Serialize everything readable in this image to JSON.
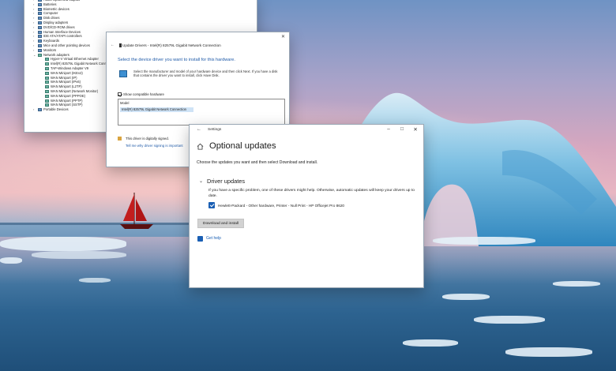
{
  "device_manager": {
    "rows": [
      {
        "label": "Audio inputs and outputs",
        "level": 0
      },
      {
        "label": "Batteries",
        "level": 0
      },
      {
        "label": "Biometric devices",
        "level": 0
      },
      {
        "label": "Computer",
        "level": 0
      },
      {
        "label": "Disk drives",
        "level": 0
      },
      {
        "label": "Display adapters",
        "level": 0
      },
      {
        "label": "DVD/CD-ROM drives",
        "level": 0
      },
      {
        "label": "Human Interface Devices",
        "level": 0
      },
      {
        "label": "IDE ATA/ATAPI controllers",
        "level": 0
      },
      {
        "label": "Keyboards",
        "level": 0
      },
      {
        "label": "Mice and other pointing devices",
        "level": 0
      },
      {
        "label": "Monitors",
        "level": 0
      },
      {
        "label": "Network adapters",
        "level": 0,
        "open": true
      },
      {
        "label": "Hyper-V Virtual Ethernet Adapter",
        "level": 1
      },
      {
        "label": "Intel(R) 82579L Gigabit Network Conn",
        "level": 1
      },
      {
        "label": "TAP-Windows Adapter V9",
        "level": 1
      },
      {
        "label": "WAN Miniport (IKEv2)",
        "level": 1
      },
      {
        "label": "WAN Miniport (IP)",
        "level": 1
      },
      {
        "label": "WAN Miniport (IPv6)",
        "level": 1
      },
      {
        "label": "WAN Miniport (L2TP)",
        "level": 1
      },
      {
        "label": "WAN Miniport (Network Monitor)",
        "level": 1
      },
      {
        "label": "WAN Miniport (PPPOE)",
        "level": 1
      },
      {
        "label": "WAN Miniport (PPTP)",
        "level": 1
      },
      {
        "label": "WAN Miniport (SSTP)",
        "level": 1
      },
      {
        "label": "Portable Devices",
        "level": 0
      }
    ]
  },
  "wizard": {
    "title": "Update Drivers - Intel(R) 82579L Gigabit Network Connection",
    "heading": "Select the device driver you want to install for this hardware.",
    "description": "Select the manufacturer and model of your hardware device and then click Next. If you have a disk that contains the driver you want to install, click Have Disk.",
    "show_compatible": "Show compatible hardware",
    "model_header": "Model",
    "model_selected": "Intel(R) 82579L Gigabit Network Connection",
    "signed_text": "This driver is digitally signed.",
    "signing_link": "Tell me why driver signing is important"
  },
  "settings": {
    "window_title": "Settings",
    "page_title": "Optional updates",
    "subtitle": "Choose the updates you want and then select Download and install.",
    "section_title": "Driver updates",
    "section_desc": "If you have a specific problem, one of these drivers might help. Otherwise, automatic updates will keep your drivers up to date.",
    "driver_item": "Hewlett-Packard  - Other hardware, Printer - Null Print - HP Officejet Pro 8620",
    "download_button": "Download and install",
    "help_link": "Get help",
    "accent_color": "#1a5fb4"
  }
}
